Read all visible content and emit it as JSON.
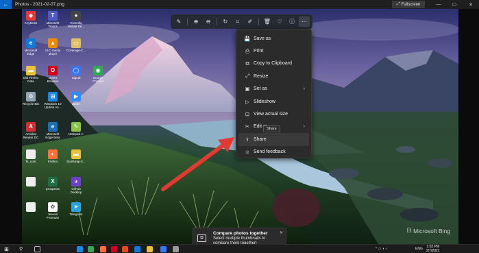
{
  "window": {
    "title": "Photos - 2021-02-07.png",
    "fullscreen_label": "Fullscreen",
    "back_glyph": "←",
    "controls": [
      "—",
      "☐",
      "✕"
    ]
  },
  "desktop_icons": [
    {
      "label": "AnyDesk",
      "color": "#e53935",
      "glyph": "◆"
    },
    {
      "label": "Microsoft Teams",
      "color": "#5059c9",
      "glyph": "T"
    },
    {
      "label": "Greenfig Mobile Se...",
      "color": "#444444",
      "glyph": "●"
    },
    {
      "label": "Microsoft Edge",
      "color": "#0f7bd8",
      "glyph": "e"
    },
    {
      "label": "VLC media player",
      "color": "#f08a00",
      "glyph": "▲"
    },
    {
      "label": "Coverage-C...",
      "color": "#e0c060",
      "glyph": "▭"
    },
    {
      "label": "Old Firefox Data",
      "color": "#e8c23d",
      "glyph": "▬"
    },
    {
      "label": "Opera Browser",
      "color": "#d0021b",
      "glyph": "O"
    },
    {
      "label": "Signal",
      "color": "#3a76f0",
      "glyph": "◯"
    },
    {
      "label": "Google Chrome",
      "color": "#34a853",
      "glyph": "◉"
    },
    {
      "label": "Recycle Bin",
      "color": "#8fa3b5",
      "glyph": "♻"
    },
    {
      "label": "Windows 10 Update As...",
      "color": "#1e88e5",
      "glyph": "⊞"
    },
    {
      "label": "Zoom",
      "color": "#2d8cff",
      "glyph": "▶"
    },
    {
      "label": "Acrobat Reader DC",
      "color": "#d32f2f",
      "glyph": "A"
    },
    {
      "label": "Microsoft Edge Beta",
      "color": "#1a6fb5",
      "glyph": "e"
    },
    {
      "label": "Notepad++",
      "color": "#8bc34a",
      "glyph": "✎"
    },
    {
      "label": "fs_com",
      "color": "#eeeeee",
      "glyph": " "
    },
    {
      "label": "Firefox",
      "color": "#ff7139",
      "glyph": "◐"
    },
    {
      "label": "bootstrap-3...",
      "color": "#e8c23d",
      "glyph": "▬"
    },
    {
      "label": "",
      "color": "#eeeeee",
      "glyph": " "
    },
    {
      "label": "prospects",
      "color": "#1d7044",
      "glyph": "X"
    },
    {
      "label": "Github Desktop",
      "color": "#6e40c9",
      "glyph": "◕"
    },
    {
      "label": "",
      "color": "#eeeeee",
      "glyph": " "
    },
    {
      "label": "Jeevan Pramaan",
      "color": "#ffffff",
      "glyph": "✿"
    },
    {
      "label": "Telegram",
      "color": "#2aa3df",
      "glyph": "➤"
    }
  ],
  "toolbar": {
    "buttons": [
      {
        "name": "edit-image",
        "glyph": "✎"
      },
      {
        "name": "zoom-in",
        "glyph": "⊕"
      },
      {
        "name": "zoom-out",
        "glyph": "⊖"
      },
      {
        "name": "rotate",
        "glyph": "↻"
      },
      {
        "name": "crop",
        "glyph": "⌗"
      },
      {
        "name": "markup",
        "glyph": "✐"
      },
      {
        "name": "delete",
        "glyph": "🗑"
      },
      {
        "name": "favorite",
        "glyph": "♡"
      },
      {
        "name": "info",
        "glyph": "ⓘ"
      },
      {
        "name": "more",
        "glyph": "···"
      }
    ]
  },
  "menu": {
    "items": [
      {
        "label": "Save as",
        "glyph": "💾",
        "submenu": false
      },
      {
        "label": "Print",
        "glyph": "⎙",
        "submenu": false
      },
      {
        "label": "Copy to Clipboard",
        "glyph": "⧉",
        "submenu": false
      },
      {
        "label": "Resize",
        "glyph": "⤢",
        "submenu": false
      },
      {
        "label": "Set as",
        "glyph": "▣",
        "submenu": true
      },
      {
        "label": "Slideshow",
        "glyph": "▷",
        "submenu": false
      },
      {
        "label": "View actual size",
        "glyph": "⊡",
        "submenu": false
      },
      {
        "label": "Edit m",
        "glyph": "✂",
        "submenu": true
      },
      {
        "label": "Share",
        "glyph": "⇪",
        "submenu": false
      },
      {
        "label": "Send feedback",
        "glyph": "☺",
        "submenu": false
      }
    ],
    "hovered_index": 8,
    "tooltip": "Share",
    "chevron": "›"
  },
  "notification": {
    "title": "Compare photos together",
    "body": "Select multiple thumbnails to compare them together!",
    "close": "✕",
    "glyph": "⧉"
  },
  "watermark": {
    "text": "Microsoft Bing",
    "glyph": "ᗷ"
  },
  "taskbar": {
    "icons": [
      {
        "name": "start",
        "color": "#ffffff"
      },
      {
        "name": "search",
        "color": "#cccccc"
      },
      {
        "name": "task-view",
        "color": "#bbbbbb"
      },
      {
        "name": "edge",
        "color": "#1e88e5"
      },
      {
        "name": "chrome",
        "color": "#34a853"
      },
      {
        "name": "firefox",
        "color": "#ff7139"
      },
      {
        "name": "opera",
        "color": "#d0021b"
      },
      {
        "name": "office",
        "color": "#e64a19"
      },
      {
        "name": "mail",
        "color": "#0f7bd8"
      },
      {
        "name": "explorer",
        "color": "#e8c23d"
      },
      {
        "name": "photos",
        "color": "#3a76f0"
      },
      {
        "name": "settings",
        "color": "#999999"
      }
    ],
    "lang": "ENG",
    "time": "1:02 PM",
    "date": "2/7/2021",
    "tray_glyphs": "^ ▭ ◖ ♪"
  },
  "colors": {
    "accent": "#0a67c7",
    "menu_bg": "#2b2b2b",
    "arrow": "#e23a32"
  }
}
